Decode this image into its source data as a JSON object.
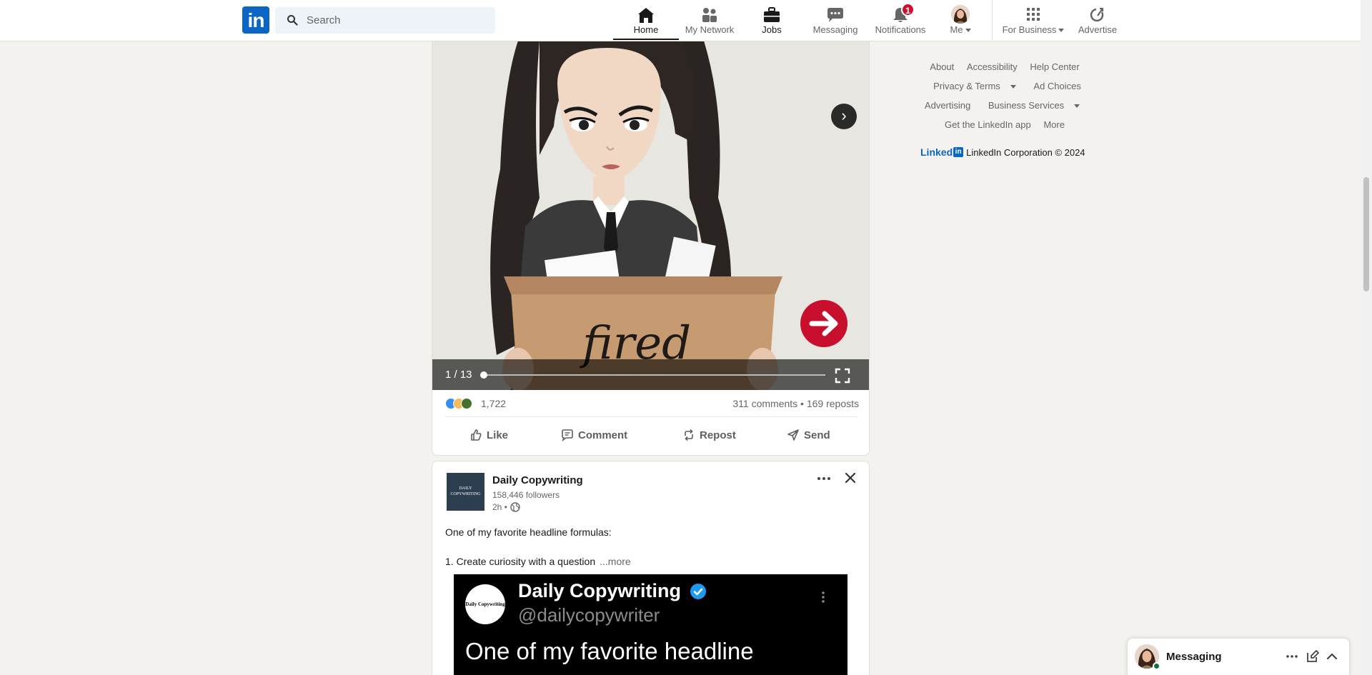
{
  "topbar": {
    "logo_text": "in",
    "search_placeholder": "Search",
    "nav": [
      {
        "label": "Home",
        "icon": "home-icon",
        "active": true
      },
      {
        "label": "My Network",
        "icon": "people-icon"
      },
      {
        "label": "Jobs",
        "icon": "briefcase-icon"
      },
      {
        "label": "Messaging",
        "icon": "chat-icon"
      },
      {
        "label": "Notifications",
        "icon": "bell-icon",
        "badge": "1"
      },
      {
        "label": "Me",
        "icon": "avatar"
      },
      {
        "label": "For Business",
        "icon": "grid-icon"
      },
      {
        "label": "Advertise",
        "icon": "advertise-icon"
      }
    ]
  },
  "post1": {
    "image_text": "fired",
    "carousel_counter": "1 / 13",
    "reaction_count": "1,722",
    "comments_reposts": "311 comments • 169 reposts",
    "actions": [
      "Like",
      "Comment",
      "Repost",
      "Send"
    ]
  },
  "post2": {
    "company_logo_text": "DAILY COPYWRITING",
    "company_name": "Daily Copywriting",
    "followers": "158,446 followers",
    "time": "2h •",
    "text_line1": "One of my favorite headline formulas:",
    "text_line2": "1. Create curiosity with a question",
    "see_more": "...more",
    "tweet": {
      "avatar_text": "Daily Copywriting",
      "name": "Daily Copywriting",
      "handle": "@dailycopywriter",
      "body": "One of my favorite headline"
    }
  },
  "footer": {
    "row1": [
      "About",
      "Accessibility",
      "Help Center"
    ],
    "row2": [
      "Privacy & Terms",
      "Ad Choices"
    ],
    "row3": [
      "Advertising",
      "Business Services"
    ],
    "row4": [
      "Get the LinkedIn app",
      "More"
    ],
    "brand_word": "Linked",
    "brand_in": "in",
    "copyright": "LinkedIn Corporation © 2024"
  },
  "messaging_dock": {
    "title": "Messaging"
  },
  "colors": {
    "brand": "#0a66c2",
    "badge": "#cb112d",
    "background": "#f4f2ee"
  }
}
